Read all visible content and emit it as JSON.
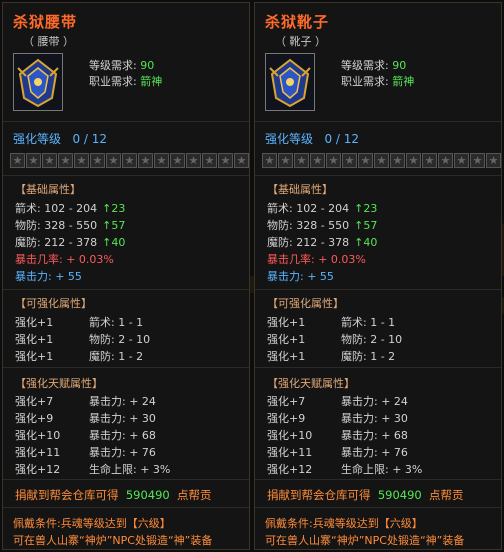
{
  "items": [
    {
      "title": "杀狱腰带",
      "subtitle": "（ 腰带 ）",
      "icon": "belt-icon",
      "level_req_label": "等级需求:",
      "level_req_value": "90",
      "class_req_label": "职业需求:",
      "class_req_value": "箭神",
      "enhance_label": "强化等级",
      "enhance_value": "0 / 12",
      "stars_total": 15,
      "base_header": "【基础属性】",
      "base": [
        {
          "text": "箭术: 102 - 204",
          "bonus": "23"
        },
        {
          "text": "物防: 328 - 550",
          "bonus": "57"
        },
        {
          "text": "魔防: 212 - 378",
          "bonus": "40"
        }
      ],
      "crit_rate": "暴击几率: + 0.03%",
      "crit_dmg": "暴击力: + 55",
      "enh_header": "【可强化属性】",
      "enh": [
        {
          "a": "强化+1",
          "b": "箭术: 1 - 1"
        },
        {
          "a": "强化+1",
          "b": "物防: 2 - 10"
        },
        {
          "a": "强化+1",
          "b": "魔防: 1 - 2"
        }
      ],
      "talent_header": "【强化天赋属性】",
      "talent": [
        {
          "a": "强化+7",
          "b": "暴击力: + 24"
        },
        {
          "a": "强化+9",
          "b": "暴击力: + 30"
        },
        {
          "a": "强化+10",
          "b": "暴击力: + 68"
        },
        {
          "a": "强化+11",
          "b": "暴击力: + 76"
        },
        {
          "a": "强化+12",
          "b": "生命上限: + 3%"
        }
      ],
      "contrib_prefix": "捐献到帮会仓库可得",
      "contrib_value": "590490",
      "contrib_suffix": "点帮贡",
      "cond1": "佩戴条件:兵魂等级达到【六级】",
      "cond2": "可在兽人山寨“神炉”NPC处锻造“神”装备"
    },
    {
      "title": "杀狱靴子",
      "subtitle": "（ 靴子 ）",
      "icon": "boots-icon",
      "level_req_label": "等级需求:",
      "level_req_value": "90",
      "class_req_label": "职业需求:",
      "class_req_value": "箭神",
      "enhance_label": "强化等级",
      "enhance_value": "0 / 12",
      "stars_total": 15,
      "base_header": "【基础属性】",
      "base": [
        {
          "text": "箭术: 102 - 204",
          "bonus": "23"
        },
        {
          "text": "物防: 328 - 550",
          "bonus": "57"
        },
        {
          "text": "魔防: 212 - 378",
          "bonus": "40"
        }
      ],
      "crit_rate": "暴击几率: + 0.03%",
      "crit_dmg": "暴击力: + 55",
      "enh_header": "【可强化属性】",
      "enh": [
        {
          "a": "强化+1",
          "b": "箭术: 1 - 1"
        },
        {
          "a": "强化+1",
          "b": "物防: 2 - 10"
        },
        {
          "a": "强化+1",
          "b": "魔防: 1 - 2"
        }
      ],
      "talent_header": "【强化天赋属性】",
      "talent": [
        {
          "a": "强化+7",
          "b": "暴击力: + 24"
        },
        {
          "a": "强化+9",
          "b": "暴击力: + 30"
        },
        {
          "a": "强化+10",
          "b": "暴击力: + 68"
        },
        {
          "a": "强化+11",
          "b": "暴击力: + 76"
        },
        {
          "a": "强化+12",
          "b": "生命上限: + 3%"
        }
      ],
      "contrib_prefix": "捐献到帮会仓库可得",
      "contrib_value": "590490",
      "contrib_suffix": "点帮贡",
      "cond1": "佩戴条件:兵魂等级达到【六级】",
      "cond2": "可在兽人山寨“神炉”NPC处锻造“神”装备"
    }
  ],
  "colors": {
    "title": "#ff6a2a",
    "green": "#55e655",
    "blue": "#5ab4ff",
    "crit": "#ff5a5a",
    "section": "#e0a878"
  }
}
